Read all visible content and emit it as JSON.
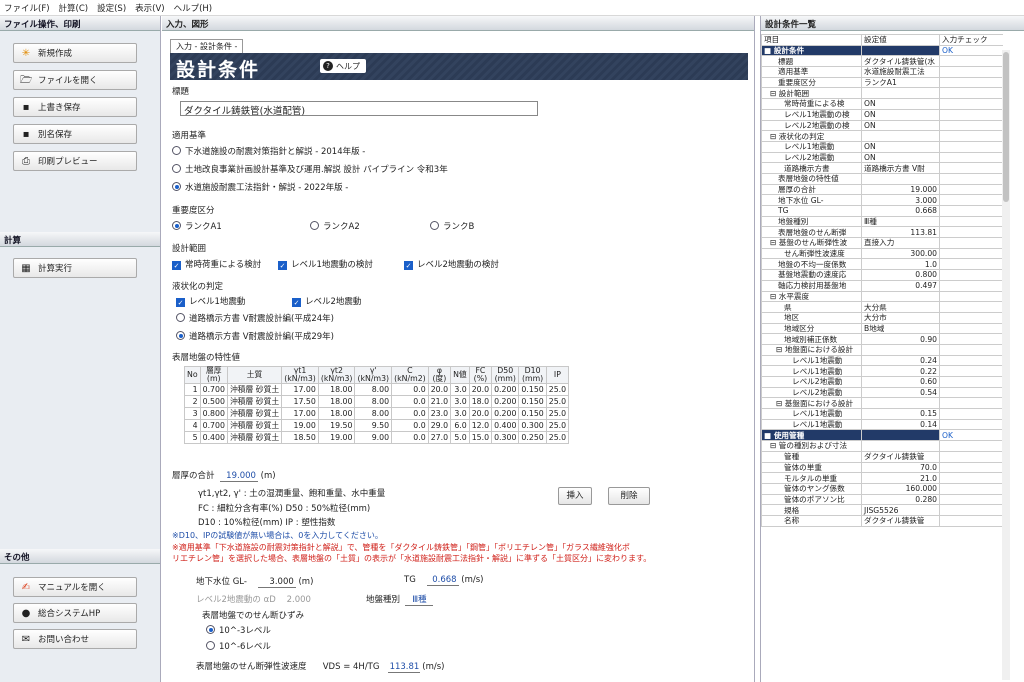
{
  "menu": [
    "ファイル(F)",
    "計算(C)",
    "設定(S)",
    "表示(V)",
    "ヘルプ(H)"
  ],
  "left": {
    "sec1": "ファイル操作、印刷",
    "new": "新規作成",
    "open": "ファイルを開く",
    "save": "上書き保存",
    "saveas": "別名保存",
    "preview": "印刷プレビュー",
    "sec2": "計算",
    "calc": "計算実行",
    "sec3": "その他",
    "manual": "マニュアルを開く",
    "hp": "総合システムHP",
    "contact": "お問い合わせ"
  },
  "center": {
    "header": "入力、図形",
    "tab": "入力 - 設計条件 -",
    "title": "設計条件",
    "help": "ヘルプ",
    "name_label": "標題",
    "name_value": "ダクタイル鋳鉄管(水道配管)",
    "std_label": "適用基準",
    "std_opts": [
      "下水道施設の耐震対策指針と解説 - 2014年版 -",
      "土地改良事業計画設計基準及び運用.解説 設計 パイプライン 令和3年",
      "水道施設耐震工法指針・解説 - 2022年版 -"
    ],
    "imp_label": "重要度区分",
    "imp_opts": [
      "ランクA1",
      "ランクA2",
      "ランクB"
    ],
    "range_label": "設計範囲",
    "range_opts": [
      "常時荷重による検討",
      "レベル1地震動の検討",
      "レベル2地震動の検討"
    ],
    "liq_label": "液状化の判定",
    "liq_chk": [
      "レベル1地震動",
      "レベル2地震動"
    ],
    "liq_opts": [
      "道路橋示方書 V耐震設計編(平成24年)",
      "道路橋示方書 V耐震設計編(平成29年)"
    ],
    "soil_label": "表層地盤の特性値",
    "table_head": [
      "No",
      "層厚\n(m)",
      "土質",
      "γt1\n(kN/m3)",
      "γt2\n(kN/m3)",
      "γ'\n(kN/m3)",
      "C\n(kN/m2)",
      "φ\n(度)",
      "N値",
      "FC\n(%)",
      "D50\n(mm)",
      "D10\n(mm)",
      "IP"
    ],
    "table_rows": [
      [
        "1",
        "0.700",
        "沖積層 砂質土",
        "17.00",
        "18.00",
        "8.00",
        "0.0",
        "20.0",
        "3.0",
        "20.0",
        "0.200",
        "0.150",
        "25.0"
      ],
      [
        "2",
        "0.500",
        "沖積層 砂質土",
        "17.50",
        "18.00",
        "8.00",
        "0.0",
        "21.0",
        "3.0",
        "18.0",
        "0.200",
        "0.150",
        "25.0"
      ],
      [
        "3",
        "0.800",
        "沖積層 砂質土",
        "17.00",
        "18.00",
        "8.00",
        "0.0",
        "23.0",
        "3.0",
        "20.0",
        "0.200",
        "0.150",
        "25.0"
      ],
      [
        "4",
        "0.700",
        "沖積層 砂質土",
        "19.00",
        "19.50",
        "9.50",
        "0.0",
        "29.0",
        "6.0",
        "12.0",
        "0.400",
        "0.300",
        "25.0"
      ],
      [
        "5",
        "0.400",
        "沖積層 砂質土",
        "18.50",
        "19.00",
        "9.00",
        "0.0",
        "27.0",
        "5.0",
        "15.0",
        "0.300",
        "0.250",
        "25.0"
      ]
    ],
    "sum_label": "層厚の合計",
    "sum_value": "19.000",
    "sum_unit": "(m)",
    "note1": "γt1,γt2, γ' : 土の湿潤重量、飽和重量、水中重量",
    "note2": "FC : 細粒分含有率(%)  D50 : 50%粒径(mm)",
    "note3": "D10 : 10%粒径(mm)  IP : 塑性指数",
    "insert": "挿入",
    "delete": "削除",
    "blue_note": "※D10、IPの試験値が無い場合は、0を入力してください。",
    "warn1": "※適用基準「下水道施設の耐震対策指針と解説」で、管種を「ダクタイル鋳鉄管」「鋼管」「ポリエチレン管」「ガラス繊維強化ポ",
    "warn2": "リエチレン管」を選択した場合、表層地盤の「土質」の表示が「水道施設耐震工法指針・解説」に準ずる「土質区分」に変わります。",
    "gwl_label": "地下水位 GL-",
    "gwl_value": "3.000",
    "gwl_unit": "(m)",
    "tg_label": "TG",
    "tg_value": "0.668",
    "tg_unit": "(m/s)",
    "l2_label": "レベル2地震動の αD",
    "l2_value": "2.000",
    "ground_label": "地盤種別",
    "ground_value": "Ⅲ種",
    "strain_label": "表層地盤でのせん断ひずみ",
    "strain_opts": [
      "10^-3レベル",
      "10^-6レベル"
    ],
    "vds_label": "表層地盤のせん断弾性波速度",
    "vds_formula": "VDS = 4H/TG",
    "vds_value": "113.81",
    "vds_unit": "(m/s)"
  },
  "right": {
    "header": "設計条件一覧",
    "cols": [
      "項目",
      "設定値",
      "入力チェック"
    ],
    "rows": [
      [
        "cat",
        "設計条件",
        "",
        "OK"
      ],
      [
        "i1",
        "標題",
        "ダクタイル鋳鉄管(水",
        ""
      ],
      [
        "i1",
        "適用基準",
        "水道施設耐震工法",
        ""
      ],
      [
        "i1",
        "重要度区分",
        "ランクA1",
        ""
      ],
      [
        "g",
        "設計範囲",
        "",
        ""
      ],
      [
        "i2",
        "常時荷重による検",
        "ON",
        ""
      ],
      [
        "i2",
        "レベル1地震動の検",
        "ON",
        ""
      ],
      [
        "i2",
        "レベル2地震動の検",
        "ON",
        ""
      ],
      [
        "g",
        "液状化の判定",
        "",
        ""
      ],
      [
        "i2",
        "レベル1地震動",
        "ON",
        ""
      ],
      [
        "i2",
        "レベル2地震動",
        "ON",
        ""
      ],
      [
        "i2",
        "道路橋示方書",
        "道路橋示方書 V耐",
        ""
      ],
      [
        "i1",
        "表層地盤の特性値",
        "",
        ""
      ],
      [
        "i1",
        "層厚の合計",
        "19.000",
        ""
      ],
      [
        "i1",
        "地下水位 GL-",
        "3.000",
        ""
      ],
      [
        "i1",
        "TG",
        "0.668",
        ""
      ],
      [
        "i1",
        "地盤種別",
        "Ⅲ種",
        ""
      ],
      [
        "i1",
        "表層地盤のせん断弾",
        "113.81",
        ""
      ],
      [
        "g",
        "基盤のせん断弾性波",
        "直接入力",
        ""
      ],
      [
        "i2",
        "せん断弾性波速度",
        "300.00",
        ""
      ],
      [
        "i1",
        "地盤の不均一度係数",
        "1.0",
        ""
      ],
      [
        "i1",
        "基盤地震動の速度応",
        "0.800",
        ""
      ],
      [
        "i1",
        "軸応力検討用基盤地",
        "0.497",
        ""
      ],
      [
        "g",
        "水平震度",
        "",
        ""
      ],
      [
        "i2",
        "県",
        "大分県",
        ""
      ],
      [
        "i2",
        "地区",
        "大分市",
        ""
      ],
      [
        "i2",
        "地域区分",
        "B地域",
        ""
      ],
      [
        "i2",
        "地域別補正係数",
        "0.90",
        ""
      ],
      [
        "g2",
        "地盤面における設計",
        "",
        ""
      ],
      [
        "i3",
        "レベル1地震動",
        "0.24",
        ""
      ],
      [
        "i3",
        "レベル1地震動",
        "0.22",
        ""
      ],
      [
        "i3",
        "レベル2地震動",
        "0.60",
        ""
      ],
      [
        "i3",
        "レベル2地震動",
        "0.54",
        ""
      ],
      [
        "g2",
        "基盤面における設計",
        "",
        ""
      ],
      [
        "i3",
        "レベル1地震動",
        "0.15",
        ""
      ],
      [
        "i3",
        "レベル1地震動",
        "0.14",
        ""
      ],
      [
        "cat",
        "使用管種",
        "",
        "OK"
      ],
      [
        "g",
        "管の種別および寸法",
        "",
        ""
      ],
      [
        "i2",
        "管種",
        "ダクタイル鋳鉄管",
        ""
      ],
      [
        "i2",
        "管体の単重",
        "70.0",
        ""
      ],
      [
        "i2",
        "モルタルの単重",
        "21.0",
        ""
      ],
      [
        "i2",
        "管体のヤング係数",
        "160.000",
        ""
      ],
      [
        "i2",
        "管体のポアソン比",
        "0.280",
        ""
      ],
      [
        "i2",
        "規格",
        "JISG5526",
        ""
      ],
      [
        "i2",
        "名称",
        "ダクタイル鋳鉄管",
        ""
      ]
    ]
  }
}
